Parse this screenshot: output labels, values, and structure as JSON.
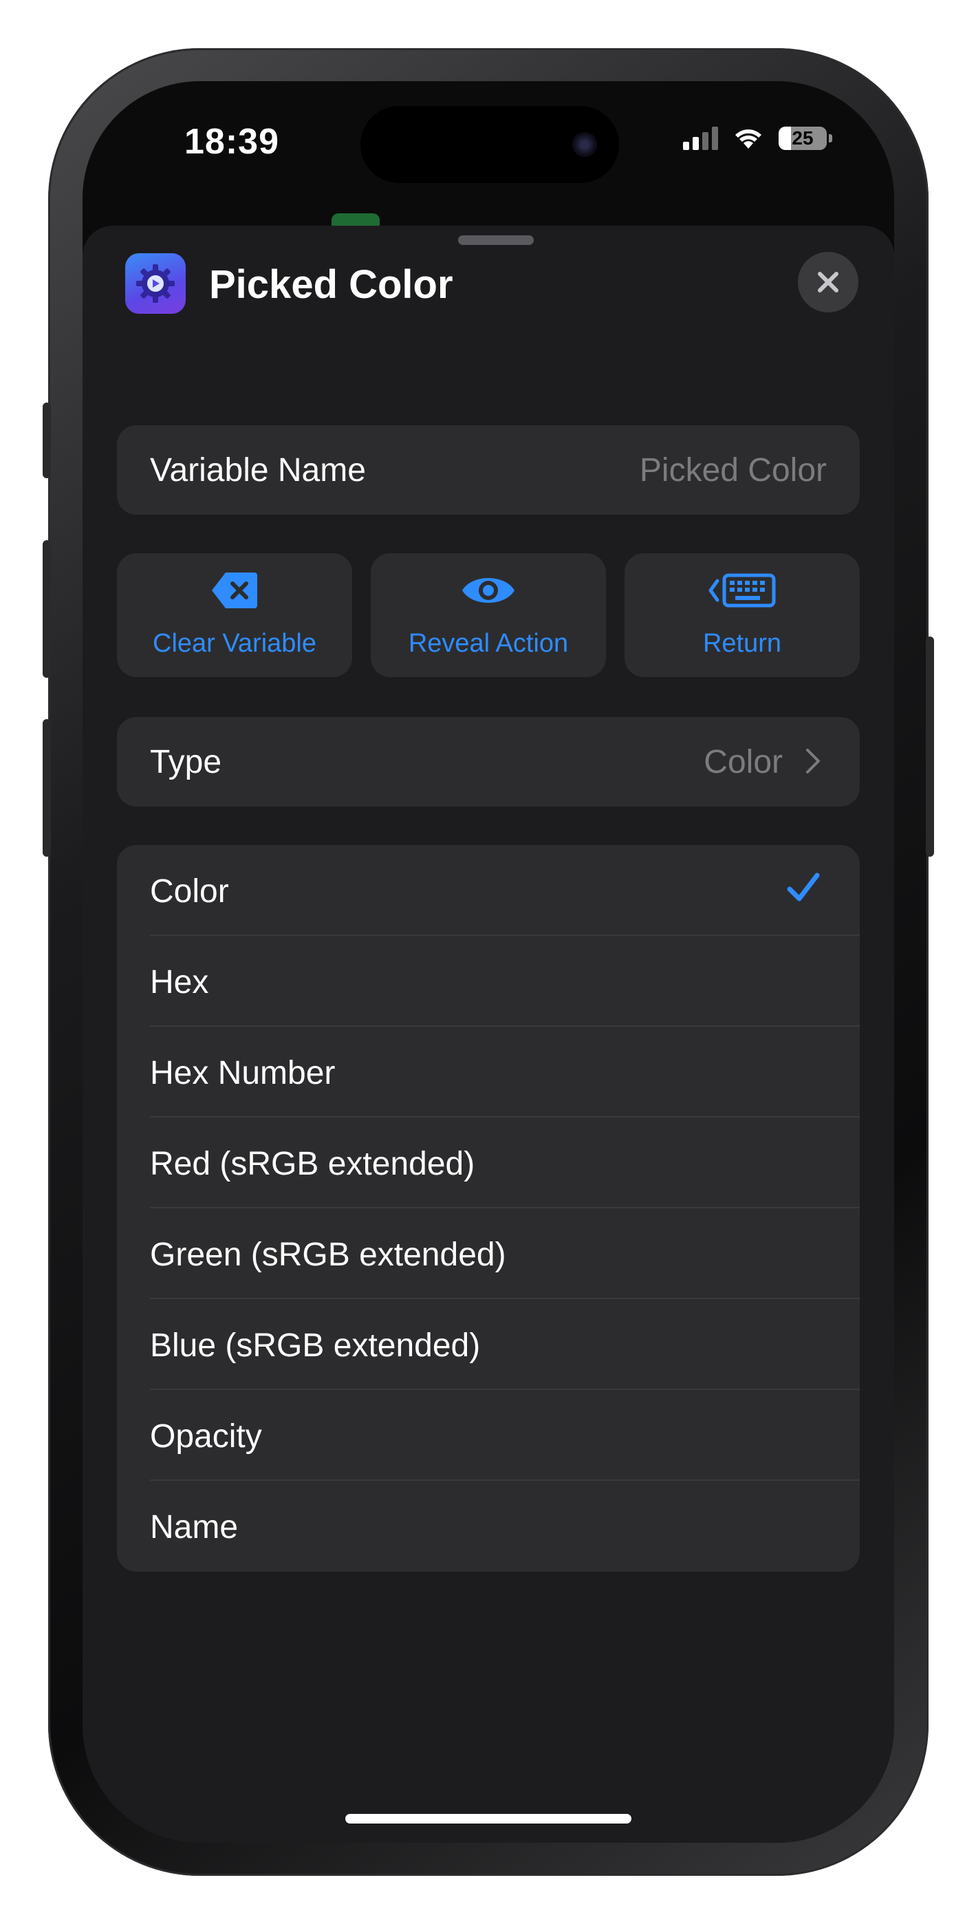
{
  "status_bar": {
    "time": "18:39",
    "battery_level": "25"
  },
  "sheet": {
    "title": "Picked Color",
    "variable_name": {
      "label": "Variable Name",
      "placeholder": "Picked Color"
    },
    "actions": [
      {
        "label": "Clear Variable",
        "icon": "delete-left-icon"
      },
      {
        "label": "Reveal Action",
        "icon": "eye-icon"
      },
      {
        "label": "Return",
        "icon": "keyboard-return-icon"
      }
    ],
    "type_row": {
      "label": "Type",
      "value": "Color"
    },
    "type_options": [
      {
        "label": "Color",
        "selected": true
      },
      {
        "label": "Hex",
        "selected": false
      },
      {
        "label": "Hex Number",
        "selected": false
      },
      {
        "label": "Red (sRGB extended)",
        "selected": false
      },
      {
        "label": "Green (sRGB extended)",
        "selected": false
      },
      {
        "label": "Blue (sRGB extended)",
        "selected": false
      },
      {
        "label": "Opacity",
        "selected": false
      },
      {
        "label": "Name",
        "selected": false
      }
    ]
  },
  "colors": {
    "accent": "#2f8cff",
    "sheet_background": "#1c1c1e",
    "card_background": "#2c2c2e",
    "secondary_text": "#7c7c80"
  }
}
